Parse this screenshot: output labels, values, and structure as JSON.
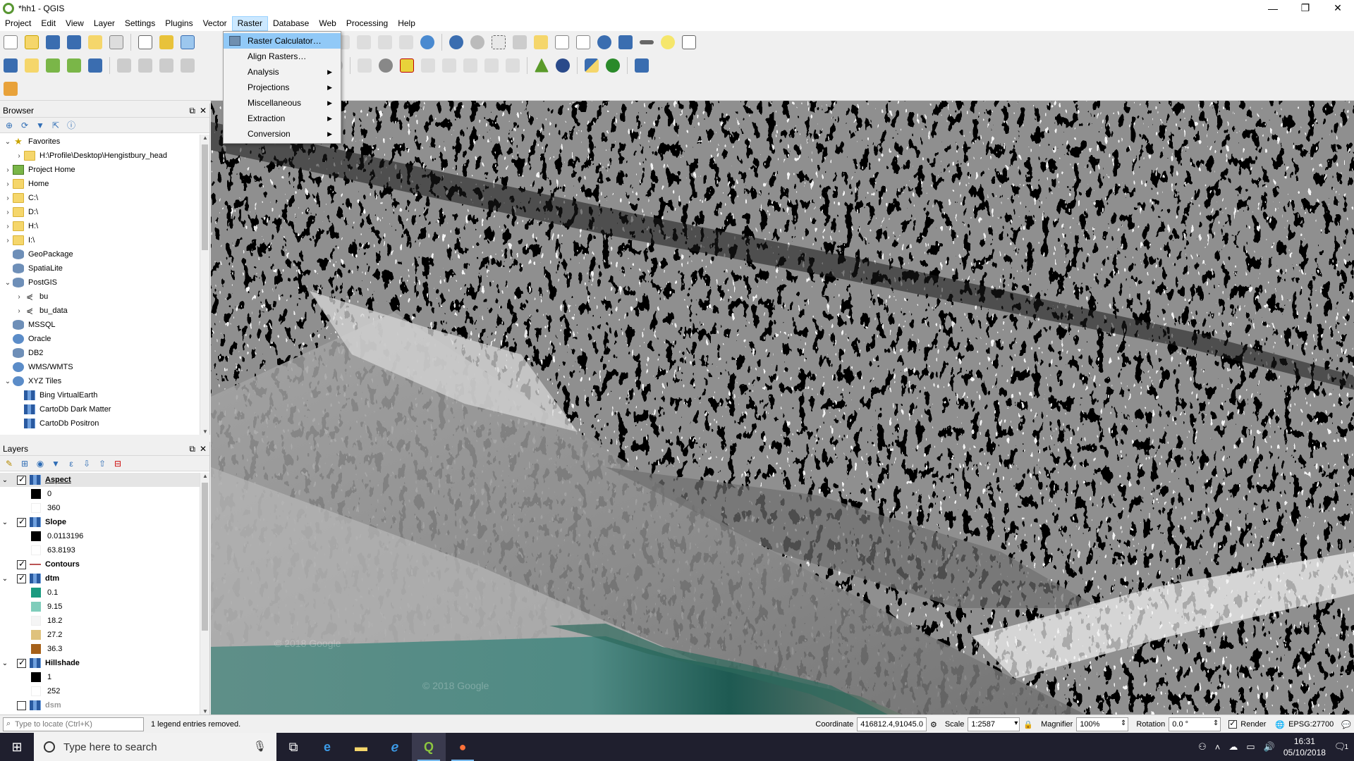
{
  "window": {
    "title": "*hh1 - QGIS",
    "minimize": "—",
    "maximize": "❐",
    "close": "✕"
  },
  "menubar": [
    "Project",
    "Edit",
    "View",
    "Layer",
    "Settings",
    "Plugins",
    "Vector",
    "Raster",
    "Database",
    "Web",
    "Processing",
    "Help"
  ],
  "raster_menu": {
    "items": [
      {
        "label": "Raster Calculator…",
        "submenu": false,
        "highlighted": true
      },
      {
        "label": "Align Rasters…",
        "submenu": false,
        "highlighted": false
      },
      {
        "label": "Analysis",
        "submenu": true,
        "highlighted": false
      },
      {
        "label": "Projections",
        "submenu": true,
        "highlighted": false
      },
      {
        "label": "Miscellaneous",
        "submenu": true,
        "highlighted": false
      },
      {
        "label": "Extraction",
        "submenu": true,
        "highlighted": false
      },
      {
        "label": "Conversion",
        "submenu": true,
        "highlighted": false
      }
    ],
    "submenu_arrow": "▶"
  },
  "browser": {
    "title": "Browser",
    "items": [
      {
        "label": "Favorites",
        "level": 0,
        "expanded": true,
        "icon": "star-icon",
        "glyph": "★"
      },
      {
        "label": "H:\\Profile\\Desktop\\Hengistbury_head",
        "level": 1,
        "expanded": false,
        "icon": "folder-icon"
      },
      {
        "label": "Project Home",
        "level": 0,
        "expanded": false,
        "icon": "project-home-icon"
      },
      {
        "label": "Home",
        "level": 0,
        "expanded": false,
        "icon": "folder-icon"
      },
      {
        "label": "C:\\",
        "level": 0,
        "expanded": false,
        "icon": "folder-icon"
      },
      {
        "label": "D:\\",
        "level": 0,
        "expanded": false,
        "icon": "folder-icon"
      },
      {
        "label": "H:\\",
        "level": 0,
        "expanded": false,
        "icon": "folder-icon"
      },
      {
        "label": "I:\\",
        "level": 0,
        "expanded": false,
        "icon": "folder-icon"
      },
      {
        "label": "GeoPackage",
        "level": 0,
        "expanded": null,
        "icon": "geopackage-icon"
      },
      {
        "label": "SpatiaLite",
        "level": 0,
        "expanded": null,
        "icon": "spatialite-icon"
      },
      {
        "label": "PostGIS",
        "level": 0,
        "expanded": true,
        "icon": "postgis-icon"
      },
      {
        "label": "bu",
        "level": 1,
        "expanded": false,
        "icon": "connection-icon",
        "glyph": "⋞"
      },
      {
        "label": "bu_data",
        "level": 1,
        "expanded": false,
        "icon": "connection-icon",
        "glyph": "⋞"
      },
      {
        "label": "MSSQL",
        "level": 0,
        "expanded": null,
        "icon": "mssql-icon"
      },
      {
        "label": "Oracle",
        "level": 0,
        "expanded": null,
        "icon": "oracle-icon"
      },
      {
        "label": "DB2",
        "level": 0,
        "expanded": null,
        "icon": "db2-icon"
      },
      {
        "label": "WMS/WMTS",
        "level": 0,
        "expanded": null,
        "icon": "wms-icon"
      },
      {
        "label": "XYZ Tiles",
        "level": 0,
        "expanded": true,
        "icon": "xyz-icon"
      },
      {
        "label": "Bing VirtualEarth",
        "level": 1,
        "expanded": null,
        "icon": "tile-icon"
      },
      {
        "label": "CartoDb Dark Matter",
        "level": 1,
        "expanded": null,
        "icon": "tile-icon"
      },
      {
        "label": "CartoDb Positron",
        "level": 1,
        "expanded": null,
        "icon": "tile-icon"
      }
    ]
  },
  "layers": {
    "title": "Layers",
    "items": [
      {
        "name": "Aspect",
        "checked": true,
        "expanded": true,
        "type": "raster",
        "selected": true,
        "underline": true,
        "legend": [
          {
            "label": "0",
            "color": "#000000"
          },
          {
            "label": "360",
            "color": "#ffffff"
          }
        ]
      },
      {
        "name": "Slope",
        "checked": true,
        "expanded": true,
        "type": "raster",
        "legend": [
          {
            "label": "0.0113196",
            "color": "#000000"
          },
          {
            "label": "63.8193",
            "color": "#ffffff"
          }
        ]
      },
      {
        "name": "Contours",
        "checked": true,
        "expanded": null,
        "type": "line",
        "legend": []
      },
      {
        "name": "dtm",
        "checked": true,
        "expanded": true,
        "type": "raster",
        "legend": [
          {
            "label": "0.1",
            "color": "#1a9a80"
          },
          {
            "label": "9.15",
            "color": "#7fcdbb"
          },
          {
            "label": "18.2",
            "color": "#f5f5f5"
          },
          {
            "label": "27.2",
            "color": "#dfc27d"
          },
          {
            "label": "36.3",
            "color": "#a6611a"
          }
        ]
      },
      {
        "name": "Hillshade",
        "checked": true,
        "expanded": true,
        "type": "raster",
        "legend": [
          {
            "label": "1",
            "color": "#000000"
          },
          {
            "label": "252",
            "color": "#ffffff"
          }
        ]
      },
      {
        "name": "dsm",
        "checked": false,
        "expanded": null,
        "type": "raster",
        "dim": true,
        "legend": []
      }
    ]
  },
  "map": {
    "watermarks": [
      "© 2018 Google",
      "© 2018 Google"
    ]
  },
  "statusbar": {
    "locator_placeholder": "Type to locate (Ctrl+K)",
    "message": "1 legend entries removed.",
    "coordinate_label": "Coordinate",
    "coordinate_value": "416812.4,91045.0",
    "scale_label": "Scale",
    "scale_value": "1:2587",
    "magnifier_label": "Magnifier",
    "magnifier_value": "100%",
    "rotation_label": "Rotation",
    "rotation_value": "0.0 °",
    "render_label": "Render",
    "render_checked": true,
    "crs": "EPSG:27700"
  },
  "taskbar": {
    "search_placeholder": "Type here to search",
    "time": "16:31",
    "date": "05/10/2018",
    "notification_count": "1"
  },
  "colors": {
    "menu_highlight": "#91c9f7",
    "taskbar_bg": "#1f1f2e",
    "qgis_green": "#589632"
  }
}
